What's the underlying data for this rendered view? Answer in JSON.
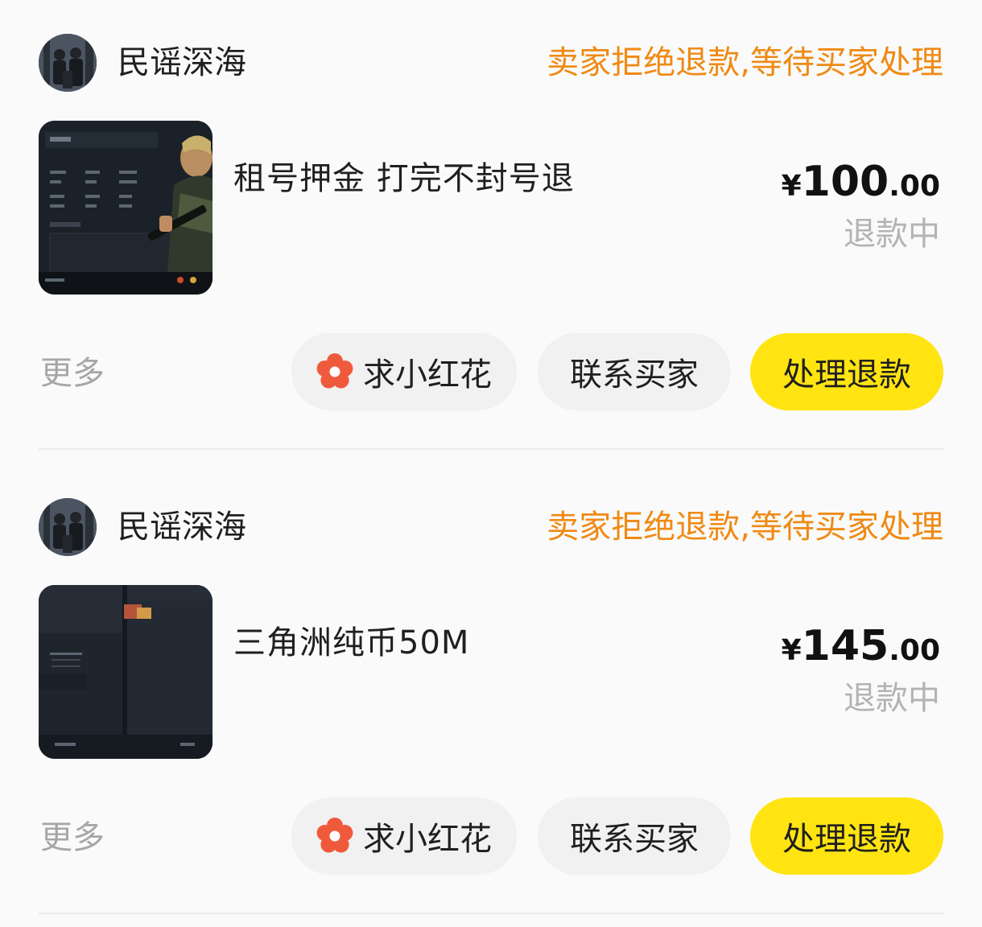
{
  "orders": [
    {
      "seller_name": "民谣深海",
      "status": "卖家拒绝退款,等待买家处理",
      "item_title": "租号押金 打完不封号退",
      "price_currency": "¥",
      "price_int": "100",
      "price_dec": ".00",
      "refund_state": "退款中",
      "more_label": "更多",
      "flower_label": "求小红花",
      "contact_label": "联系买家",
      "refund_label": "处理退款"
    },
    {
      "seller_name": "民谣深海",
      "status": "卖家拒绝退款,等待买家处理",
      "item_title": "三角洲纯币50M",
      "price_currency": "¥",
      "price_int": "145",
      "price_dec": ".00",
      "refund_state": "退款中",
      "more_label": "更多",
      "flower_label": "求小红花",
      "contact_label": "联系买家",
      "refund_label": "处理退款"
    }
  ],
  "colors": {
    "status": "#ef8a14",
    "primary_button": "#ffe411",
    "secondary_button": "#f1f1f1",
    "muted_text": "#a6a6a6",
    "flower_icon": "#f05a3c"
  },
  "icons": {
    "flower": "flower-icon",
    "avatar": "avatar",
    "thumbnail": "product-thumbnail"
  }
}
